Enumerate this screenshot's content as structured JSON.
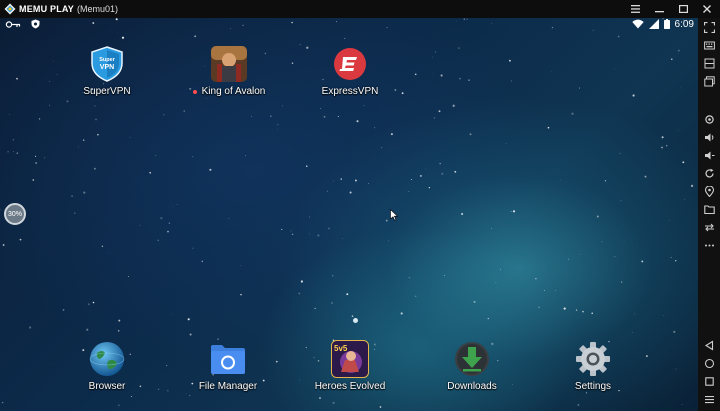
{
  "window": {
    "brand": "MEMU PLAY",
    "instance": "(Memu01)"
  },
  "status": {
    "time": "6:09"
  },
  "home": {
    "apps": [
      {
        "label": "SuperVPN",
        "icon": "supervpn-icon",
        "icon_text": "Super VPN"
      },
      {
        "label": "King of Avalon",
        "icon": "king-of-avalon-icon",
        "badge": "new-indicator"
      },
      {
        "label": "ExpressVPN",
        "icon": "expressvpn-icon"
      }
    ],
    "dock": [
      {
        "label": "Browser",
        "icon": "globe-icon"
      },
      {
        "label": "File Manager",
        "icon": "folder-icon"
      },
      {
        "label": "Heroes Evolved",
        "icon": "heroes-evolved-icon",
        "icon_text": "5v5"
      },
      {
        "label": "Downloads",
        "icon": "download-icon"
      },
      {
        "label": "Settings",
        "icon": "gear-icon"
      }
    ]
  },
  "overlay": {
    "zoom": "30%"
  },
  "colors": {
    "titlebar_bg": "#0d0d0d",
    "sidebar_bg": "#111111",
    "expressvpn_red": "#da3940",
    "supervpn_blue": "#2a9be0",
    "folder_blue": "#3d7fdc",
    "download_green": "#3fa34d"
  }
}
